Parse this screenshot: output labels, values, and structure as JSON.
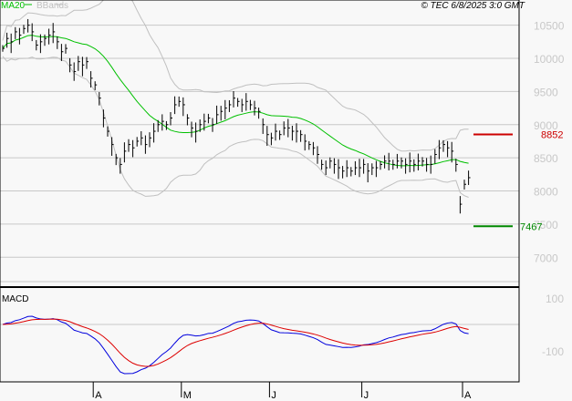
{
  "header": {
    "legend_ma": "MA20",
    "legend_bb": "BBands",
    "copyright": "© TEC 6/8/2025 3:0 GMT"
  },
  "colors": {
    "ma": "#00c000",
    "bb": "#c0c0c0",
    "resistance": "#cc0000",
    "support": "#008800",
    "macd": "#0000dd",
    "signal": "#dd0000"
  },
  "chart_data": {
    "type": "ohlc",
    "title": "",
    "y_ticks": [
      {
        "v": 10500,
        "label": "10500"
      },
      {
        "v": 10000,
        "label": "10000"
      },
      {
        "v": 9500,
        "label": "9500"
      },
      {
        "v": 9000,
        "label": "9000"
      },
      {
        "v": 8500,
        "label": "8500"
      },
      {
        "v": 8000,
        "label": "8000"
      },
      {
        "v": 7500,
        "label": "7500"
      },
      {
        "v": 7000,
        "label": "7000"
      }
    ],
    "ylim": [
      6550,
      10880
    ],
    "closes": [
      10150,
      10300,
      10250,
      10400,
      10350,
      10450,
      10500,
      10400,
      10200,
      10250,
      10300,
      10350,
      10400,
      10250,
      10100,
      10150,
      9900,
      9800,
      9950,
      9900,
      9950,
      9700,
      9600,
      9400,
      9100,
      8900,
      8700,
      8500,
      8400,
      8600,
      8700,
      8650,
      8750,
      8800,
      8700,
      8800,
      8900,
      9000,
      9050,
      9000,
      9100,
      9300,
      9350,
      9300,
      9100,
      8950,
      8900,
      9000,
      9050,
      9100,
      9000,
      9150,
      9200,
      9250,
      9300,
      9400,
      9350,
      9300,
      9350,
      9300,
      9250,
      9200,
      9000,
      8850,
      8800,
      8900,
      8850,
      8950,
      8950,
      8900,
      8900,
      8850,
      8750,
      8700,
      8650,
      8550,
      8400,
      8350,
      8450,
      8400,
      8350,
      8300,
      8350,
      8300,
      8350,
      8350,
      8400,
      8300,
      8350,
      8350,
      8400,
      8450,
      8450,
      8400,
      8450,
      8450,
      8400,
      8450,
      8400,
      8450,
      8450,
      8400,
      8400,
      8550,
      8650,
      8700,
      8650,
      8600,
      8400,
      7800,
      8100,
      8200
    ],
    "levels": [
      {
        "name": "resistance",
        "value": 8852,
        "label": "8852"
      },
      {
        "name": "support",
        "value": 7467,
        "label": "7467"
      }
    ],
    "macd": {
      "title": "MACD",
      "ticks": [
        {
          "v": 100,
          "label": "100"
        },
        {
          "v": -100,
          "label": "-100"
        }
      ]
    },
    "x_ticks": [
      {
        "index": 22,
        "label": "A"
      },
      {
        "index": 43,
        "label": "M"
      },
      {
        "index": 64,
        "label": "J"
      },
      {
        "index": 86,
        "label": "J"
      },
      {
        "index": 110,
        "label": "A"
      }
    ]
  }
}
